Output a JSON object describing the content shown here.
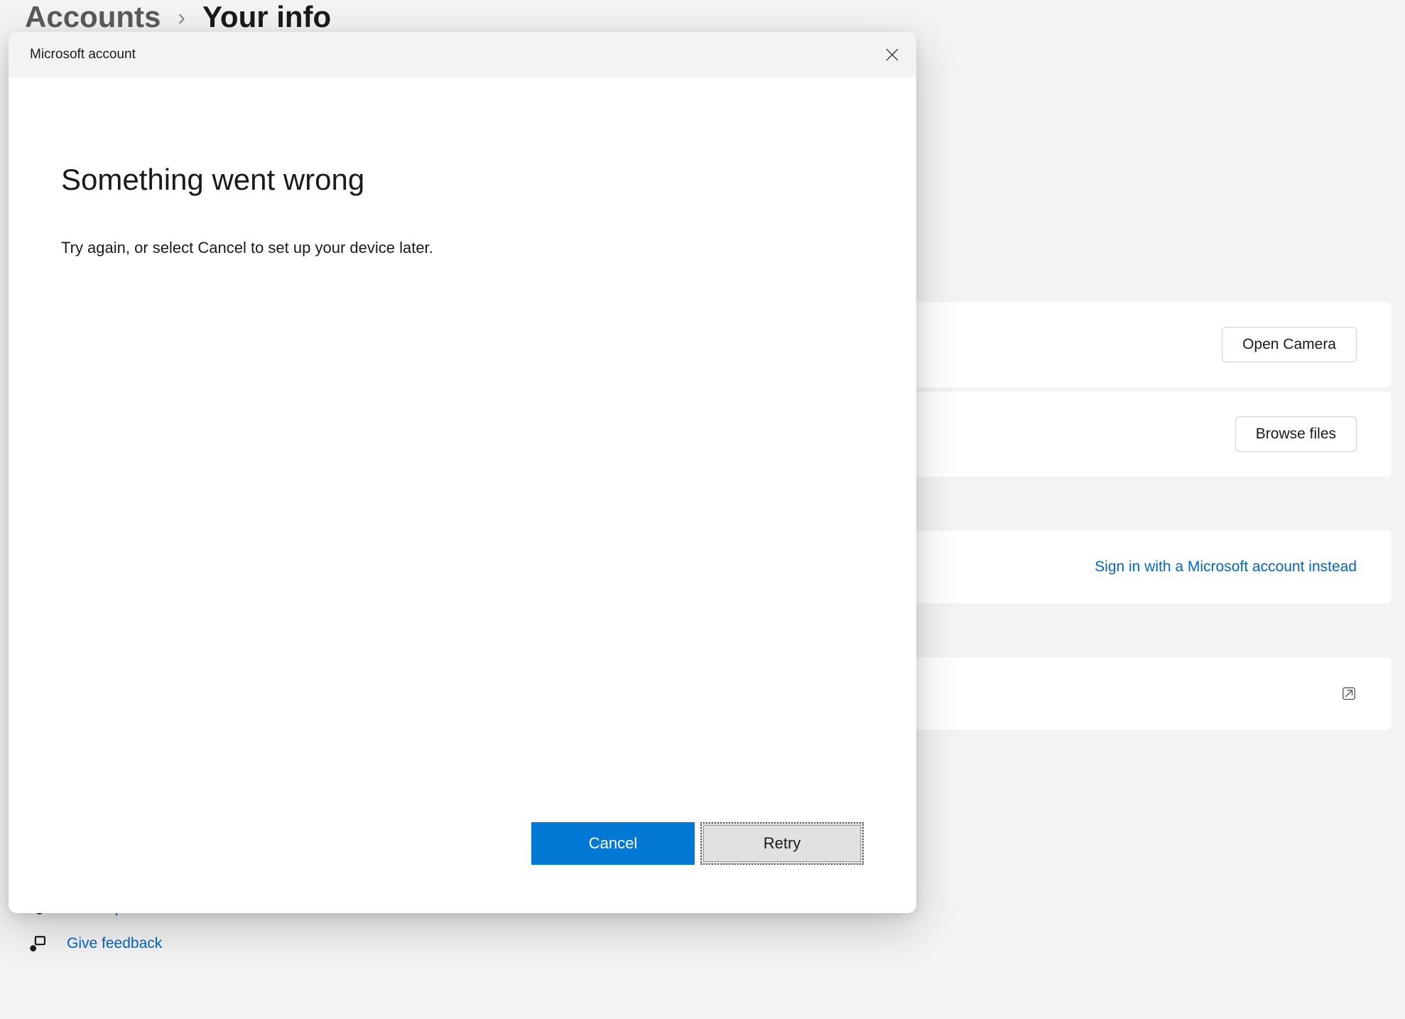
{
  "breadcrumb": {
    "parent": "Accounts",
    "current": "Your info"
  },
  "settings": {
    "open_camera_label": "Open Camera",
    "browse_files_label": "Browse files",
    "signin_link": "Sign in with a Microsoft account instead"
  },
  "help": {
    "get_help_label": "Get help",
    "give_feedback_label": "Give feedback"
  },
  "dialog": {
    "titlebar": "Microsoft account",
    "heading": "Something went wrong",
    "message": "Try again, or select Cancel to set up your device later.",
    "cancel_label": "Cancel",
    "retry_label": "Retry"
  }
}
